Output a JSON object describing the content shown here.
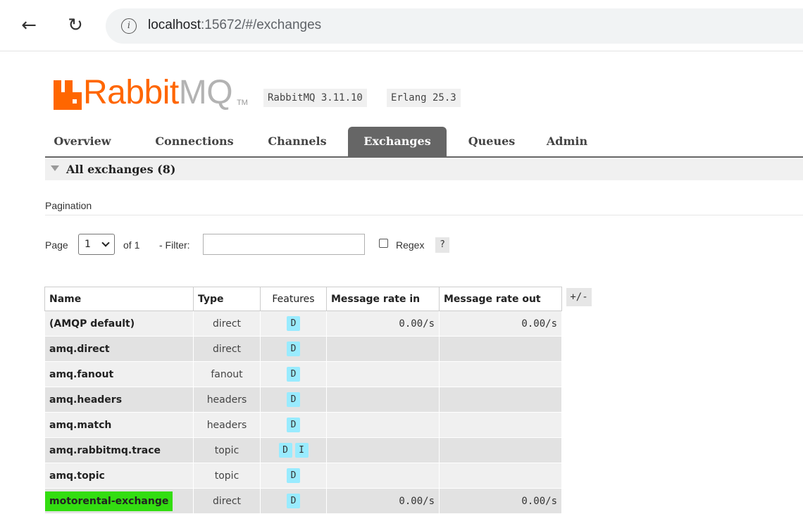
{
  "browser": {
    "url_host": "localhost",
    "url_path": ":15672/#/exchanges",
    "info_glyph": "i"
  },
  "header": {
    "logo_word_primary": "Rabbit",
    "logo_word_secondary": "MQ",
    "logo_tm": "TM",
    "version_rabbitmq": "RabbitMQ 3.11.10",
    "version_erlang": "Erlang 25.3",
    "brand_color": "#ff6600"
  },
  "tabs": [
    {
      "label": "Overview"
    },
    {
      "label": "Connections"
    },
    {
      "label": "Channels"
    },
    {
      "label": "Exchanges",
      "active": true
    },
    {
      "label": "Queues"
    },
    {
      "label": "Admin"
    }
  ],
  "section": {
    "title": "All exchanges (8)"
  },
  "pagination": {
    "label": "Pagination",
    "page_label": "Page",
    "page_value": "1",
    "of_label": "of 1",
    "filter_label": "- Filter:",
    "filter_value": "",
    "regex_label": "Regex",
    "help_label": "?"
  },
  "table": {
    "columns": [
      "Name",
      "Type",
      "Features",
      "Message rate in",
      "Message rate out"
    ],
    "columns_toggle": "+/-",
    "rows": [
      {
        "name": "(AMQP default)",
        "type": "direct",
        "features": [
          "D"
        ],
        "rate_in": "0.00/s",
        "rate_out": "0.00/s"
      },
      {
        "name": "amq.direct",
        "type": "direct",
        "features": [
          "D"
        ],
        "rate_in": "",
        "rate_out": ""
      },
      {
        "name": "amq.fanout",
        "type": "fanout",
        "features": [
          "D"
        ],
        "rate_in": "",
        "rate_out": ""
      },
      {
        "name": "amq.headers",
        "type": "headers",
        "features": [
          "D"
        ],
        "rate_in": "",
        "rate_out": ""
      },
      {
        "name": "amq.match",
        "type": "headers",
        "features": [
          "D"
        ],
        "rate_in": "",
        "rate_out": ""
      },
      {
        "name": "amq.rabbitmq.trace",
        "type": "topic",
        "features": [
          "D",
          "I"
        ],
        "rate_in": "",
        "rate_out": ""
      },
      {
        "name": "amq.topic",
        "type": "topic",
        "features": [
          "D"
        ],
        "rate_in": "",
        "rate_out": ""
      },
      {
        "name": "motorental-exchange",
        "type": "direct",
        "features": [
          "D"
        ],
        "rate_in": "0.00/s",
        "rate_out": "0.00/s",
        "highlight": true
      }
    ]
  },
  "colors": {
    "active_tab": "#666666",
    "feature_badge": "#99ebff",
    "highlight": "#33dd11"
  }
}
